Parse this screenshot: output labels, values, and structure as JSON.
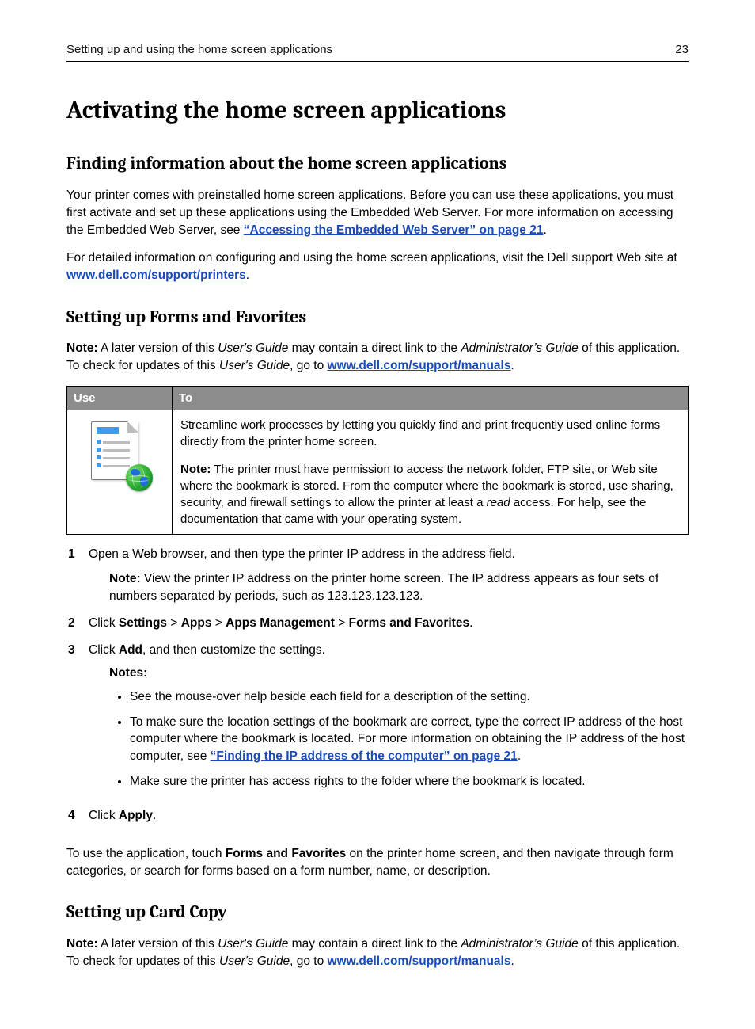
{
  "header": {
    "section_title": "Setting up and using the home screen applications",
    "page_number": "23"
  },
  "h1": "Activating the home screen applications",
  "sec1": {
    "heading": "Finding information about the home screen applications",
    "p1a": "Your printer comes with preinstalled home screen applications. Before you can use these applications, you must first activate and set up these applications using the Embedded Web Server. For more information on accessing the Embedded Web Server, see ",
    "p1_link": "“Accessing the Embedded Web Server” on page 21",
    "p1b": ".",
    "p2a": "For detailed information on configuring and using the home screen applications, visit the Dell support Web site at ",
    "p2_link": "www.dell.com/support/printers",
    "p2b": "."
  },
  "sec2": {
    "heading": "Setting up Forms and Favorites",
    "note_prefix": "Note:",
    "note_a": " A later version of this ",
    "note_ug": "User's Guide",
    "note_b": " may contain a direct link to the ",
    "note_ag": "Administrator’s Guide",
    "note_c": " of this application. To check for updates of this ",
    "note_d": ", go to ",
    "note_link": "www.dell.com/support/manuals",
    "note_e": ".",
    "table": {
      "col_use": "Use",
      "col_to": "To",
      "desc_p1": "Streamline work processes by letting you quickly find and print frequently used online forms directly from the printer home screen.",
      "desc_note_prefix": "Note:",
      "desc_note_a": " The printer must have permission to access the network folder, FTP site, or Web site where the bookmark is stored. From the computer where the bookmark is stored, use sharing, security, and firewall settings to allow the printer at least a ",
      "desc_read": "read",
      "desc_note_b": " access. For help, see the documentation that came with your operating system."
    },
    "steps": {
      "s1": "Open a Web browser, and then type the printer IP address in the address field.",
      "s1_note_prefix": "Note:",
      "s1_note": " View the printer IP address on the printer home screen. The IP address appears as four sets of numbers separated by periods, such as 123.123.123.123.",
      "s2_a": "Click ",
      "s2_settings": "Settings",
      "s2_gt": " > ",
      "s2_apps": "Apps",
      "s2_appsmgmt": "Apps Management",
      "s2_ff": "Forms and Favorites",
      "s2_end": ".",
      "s3_a": "Click ",
      "s3_add": "Add",
      "s3_b": ", and then customize the settings.",
      "notes_label": "Notes:",
      "b1": "See the mouse-over help beside each field for a description of the setting.",
      "b2a": "To make sure the location settings of the bookmark are correct, type the correct IP address of the host computer where the bookmark is located. For more information on obtaining the IP address of the host computer, see ",
      "b2_link": "“Finding the IP address of the computer” on page 21",
      "b2b": ".",
      "b3": "Make sure the printer has access rights to the folder where the bookmark is located.",
      "s4_a": "Click ",
      "s4_apply": "Apply",
      "s4_b": "."
    },
    "tail_a": "To use the application, touch ",
    "tail_ff": "Forms and Favorites",
    "tail_b": " on the printer home screen, and then navigate through form categories, or search for forms based on a form number, name, or description."
  },
  "sec3": {
    "heading": "Setting up Card Copy",
    "note_prefix": "Note:",
    "note_a": " A later version of this ",
    "note_ug": "User's Guide",
    "note_b": " may contain a direct link to the ",
    "note_ag": "Administrator’s Guide",
    "note_c": " of this application. To check for updates of this ",
    "note_d": ", go to ",
    "note_link": "www.dell.com/support/manuals",
    "note_e": "."
  }
}
